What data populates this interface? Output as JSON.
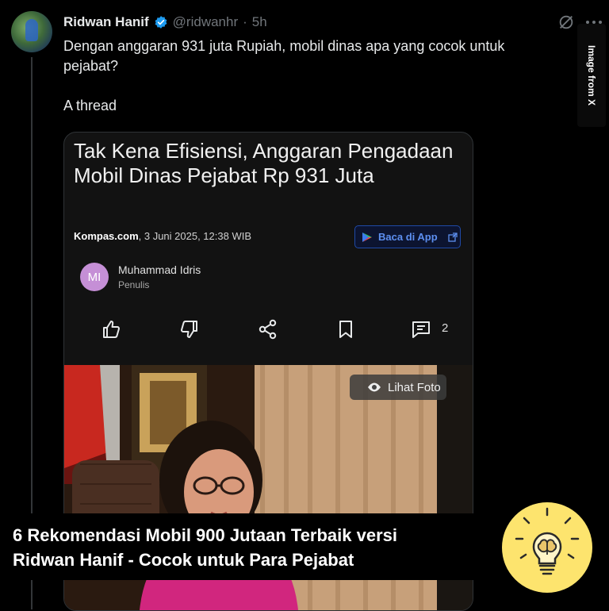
{
  "tweet": {
    "display_name": "Ridwan Hanif",
    "handle": "@ridwanhr",
    "time": "5h",
    "separator": "·",
    "line1": "Dengan anggaran 931 juta Rupiah, mobil dinas apa yang cocok untuk",
    "line2": "pejabat?",
    "line3": "A thread"
  },
  "side_label": "Image from X",
  "card": {
    "title": "Tak Kena Efisiensi, Anggaran Pengadaan Mobil Dinas Pejabat Rp 931 Juta",
    "source": "Kompas.com",
    "date": ", 3 Juni 2025, 12:38 WIB",
    "app_button": "Baca di App",
    "author_initials": "MI",
    "author_name": "Muhammad Idris",
    "author_role": "Penulis",
    "comment_count": "2",
    "photo_button": "Lihat Foto"
  },
  "banner": {
    "line1": "6 Rekomendasi Mobil 900 Jutaan Terbaik versi",
    "line2": "Ridwan Hanif - Cocok untuk Para Pejabat"
  },
  "icons": {
    "verified": "verified-badge-icon",
    "grok": "grok-icon",
    "more": "more-icon",
    "like": "thumbs-up-icon",
    "dislike": "thumbs-down-icon",
    "share": "share-icon",
    "bookmark": "bookmark-icon",
    "comment": "comment-icon",
    "eye": "eye-icon",
    "bulb": "lightbulb-brain-icon"
  },
  "colors": {
    "background": "#000000",
    "verified": "#1d9bf0",
    "app_button_text": "#5d8ff0",
    "author_avatar": "#c58fd6",
    "bulb_circle": "#fde46e"
  }
}
